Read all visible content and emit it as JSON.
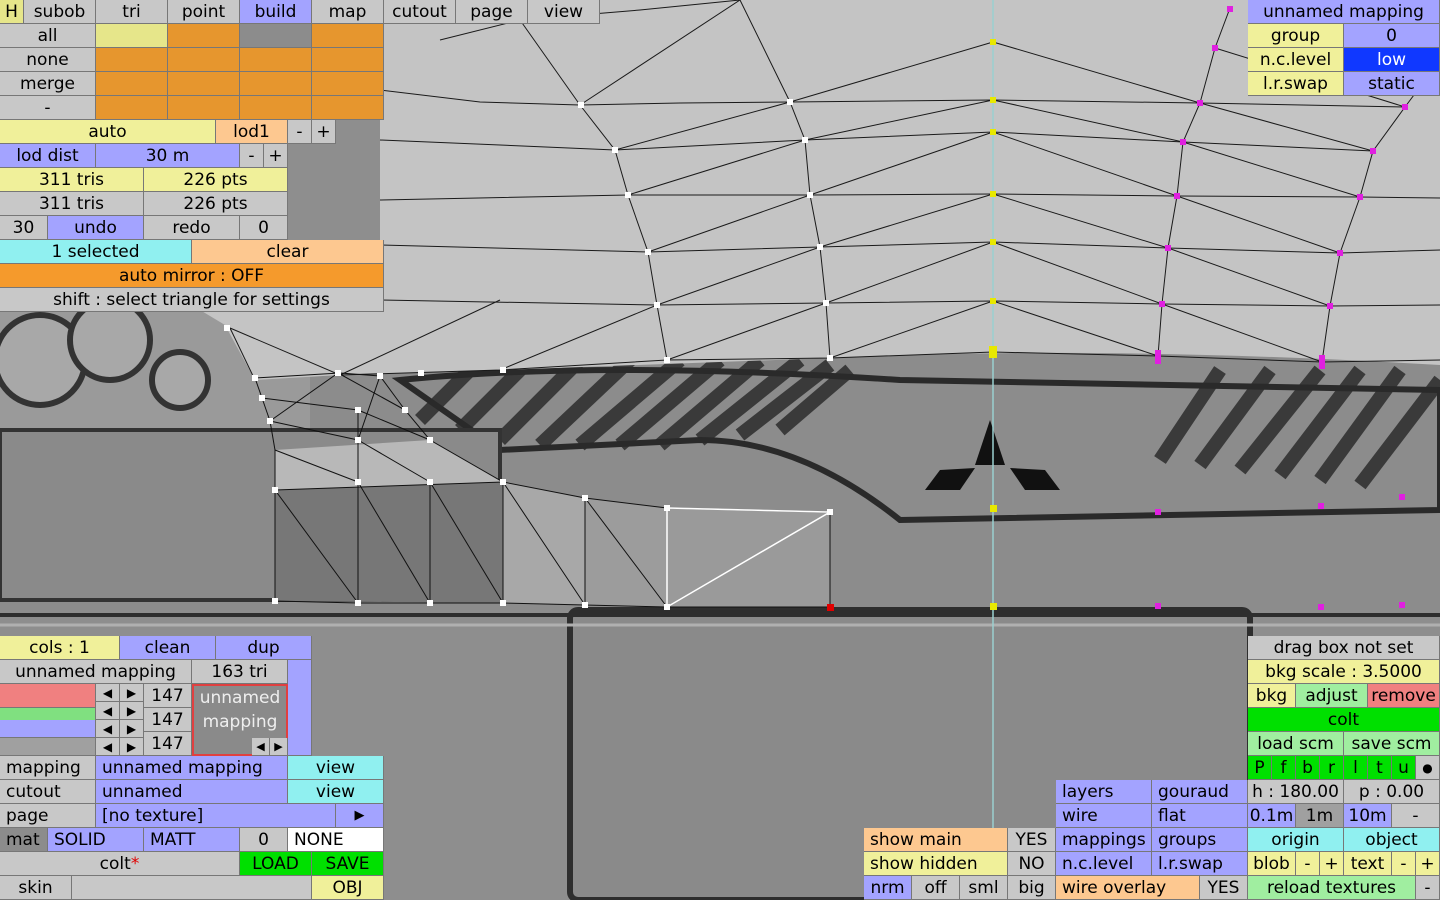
{
  "top_menu": [
    "H",
    "subob",
    "tri",
    "point",
    "build",
    "map",
    "cutout",
    "page",
    "view"
  ],
  "selection": {
    "rows": [
      "all",
      "none",
      "merge",
      "-"
    ]
  },
  "lod": {
    "auto": "auto",
    "level": "lod1",
    "minus": "-",
    "plus": "+",
    "dist_label": "lod dist",
    "dist_value": "30 m"
  },
  "stats": {
    "tris1": "311 tris",
    "pts1": "226 pts",
    "tris2": "311 tris",
    "pts2": "226 pts"
  },
  "undo": {
    "count": "30",
    "undo": "undo",
    "redo": "redo",
    "redo_count": "0"
  },
  "sel": {
    "selected": "1 selected",
    "clear": "clear",
    "mirror": "auto mirror : OFF",
    "hint": "shift : select triangle for settings"
  },
  "mapping_panel": {
    "title": "unnamed mapping",
    "group_label": "group",
    "group_value": "0",
    "nc_label": "n.c.level",
    "nc_value": "low",
    "lr_label": "l.r.swap",
    "lr_value": "static"
  },
  "cols": {
    "label": "cols : 1",
    "clean": "clean",
    "dup": "dup"
  },
  "mapping_name": "unnamed mapping",
  "tri_count": "163 tri",
  "rgb": {
    "r": "147",
    "g": "147",
    "b": "147"
  },
  "preview": {
    "line1": "unnamed",
    "line2": "mapping"
  },
  "props": {
    "mapping_label": "mapping",
    "mapping_value": "unnamed mapping",
    "mapping_view": "view",
    "cutout_label": "cutout",
    "cutout_value": "unnamed",
    "cutout_view": "view",
    "page_label": "page",
    "page_value": "[no texture]",
    "mat_label": "mat",
    "solid": "SOLID",
    "matt": "MATT",
    "mat_num": "0",
    "none": "NONE",
    "file": "colt",
    "star": "*",
    "load": "LOAD",
    "save": "SAVE",
    "skin": "skin",
    "obj": "OBJ"
  },
  "bkg": {
    "drag": "drag box not set",
    "scale": "bkg scale : 3.5000",
    "bkg": "bkg",
    "adjust": "adjust",
    "remove": "remove",
    "name": "colt",
    "load_scm": "load scm",
    "save_scm": "save scm",
    "letters": [
      "P",
      "f",
      "b",
      "r",
      "l",
      "t",
      "u"
    ],
    "dot": "●",
    "h": "h : 180.00",
    "p": "p : 0.00",
    "s1": "0.1m",
    "s2": "1m",
    "s3": "10m",
    "s4": "-",
    "origin": "origin",
    "object": "object",
    "blob": "blob",
    "minus": "-",
    "plus": "+",
    "text": "text",
    "reload": "reload textures",
    "extra": "-"
  },
  "display": {
    "layers": "layers",
    "gouraud": "gouraud",
    "wire": "wire",
    "flat": "flat",
    "mappings": "mappings",
    "groups": "groups",
    "nc": "n.c.level",
    "lr": "l.r.swap",
    "overlay": "wire overlay",
    "overlay_value": "YES"
  },
  "show": {
    "main": "show main",
    "main_value": "YES",
    "hidden": "show hidden",
    "hidden_value": "NO",
    "nrm": "nrm",
    "off": "off",
    "sml": "sml",
    "big": "big"
  }
}
